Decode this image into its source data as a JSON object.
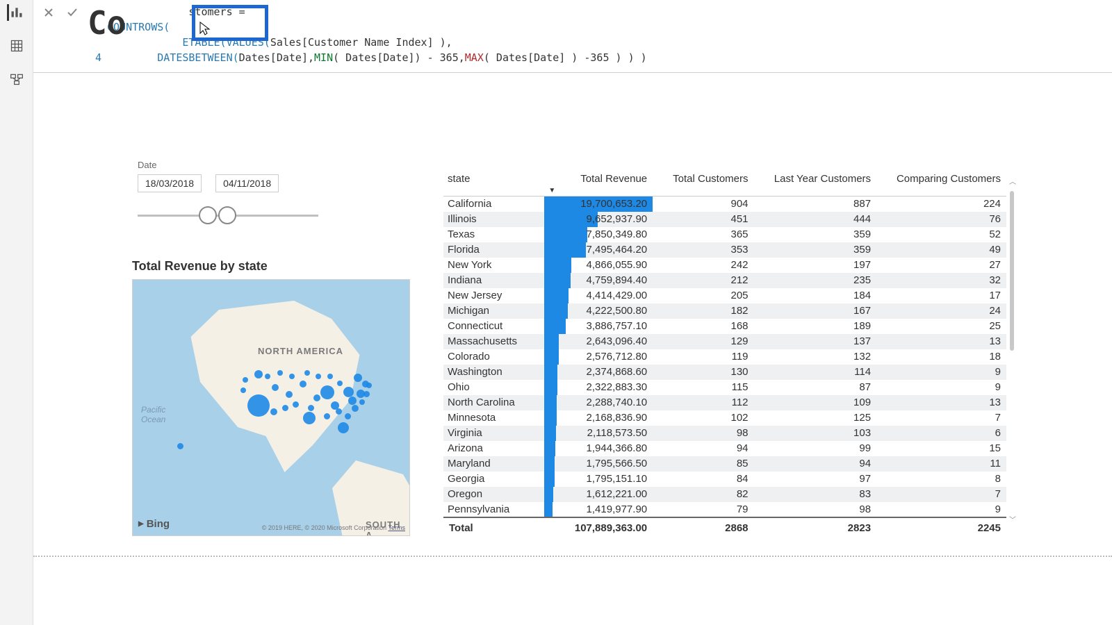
{
  "page_title_behind": "Co",
  "formula": {
    "line1_suffix": "stomers =",
    "countrows": "COUNTROWS(",
    "calculatetable_tail": "ETABLE(",
    "values_fn": "VALUES(",
    "values_arg": " Sales[Customer Name Index] ),",
    "line4_gutter": "4",
    "datesbetween": "DATESBETWEEN(",
    "dates_arg1": " Dates[Date], ",
    "min": "MIN",
    "min_tail": "( Dates[Date]) - 365, ",
    "max": "MAX",
    "max_tail": "( Dates[Date] ) -365 ) ) )"
  },
  "date_slicer": {
    "label": "Date",
    "from": "18/03/2018",
    "to": "04/11/2018"
  },
  "map": {
    "title": "Total Revenue by state",
    "continent": "NORTH AMERICA",
    "continent2": "SOUTH A",
    "ocean": "Pacific\nOcean",
    "bing": "Bing",
    "attrib": "© 2019 HERE, © 2020 Microsoft Corporation",
    "terms": "Terms"
  },
  "table": {
    "headers": {
      "state": "state",
      "rev": "Total Revenue",
      "cust": "Total Customers",
      "ly": "Last Year Customers",
      "comp": "Comparing Customers"
    },
    "max_revenue": 19700653.2,
    "rows": [
      {
        "state": "California",
        "rev": "19,700,653.20",
        "rev_n": 19700653.2,
        "cust": "904",
        "ly": "887",
        "comp": "224"
      },
      {
        "state": "Illinois",
        "rev": "9,652,937.90",
        "rev_n": 9652937.9,
        "cust": "451",
        "ly": "444",
        "comp": "76"
      },
      {
        "state": "Texas",
        "rev": "7,850,349.80",
        "rev_n": 7850349.8,
        "cust": "365",
        "ly": "359",
        "comp": "52"
      },
      {
        "state": "Florida",
        "rev": "7,495,464.20",
        "rev_n": 7495464.2,
        "cust": "353",
        "ly": "359",
        "comp": "49"
      },
      {
        "state": "New York",
        "rev": "4,866,055.90",
        "rev_n": 4866055.9,
        "cust": "242",
        "ly": "197",
        "comp": "27"
      },
      {
        "state": "Indiana",
        "rev": "4,759,894.40",
        "rev_n": 4759894.4,
        "cust": "212",
        "ly": "235",
        "comp": "32"
      },
      {
        "state": "New Jersey",
        "rev": "4,414,429.00",
        "rev_n": 4414429.0,
        "cust": "205",
        "ly": "184",
        "comp": "17"
      },
      {
        "state": "Michigan",
        "rev": "4,222,500.80",
        "rev_n": 4222500.8,
        "cust": "182",
        "ly": "167",
        "comp": "24"
      },
      {
        "state": "Connecticut",
        "rev": "3,886,757.10",
        "rev_n": 3886757.1,
        "cust": "168",
        "ly": "189",
        "comp": "25"
      },
      {
        "state": "Massachusetts",
        "rev": "2,643,096.40",
        "rev_n": 2643096.4,
        "cust": "129",
        "ly": "137",
        "comp": "13"
      },
      {
        "state": "Colorado",
        "rev": "2,576,712.80",
        "rev_n": 2576712.8,
        "cust": "119",
        "ly": "132",
        "comp": "18"
      },
      {
        "state": "Washington",
        "rev": "2,374,868.60",
        "rev_n": 2374868.6,
        "cust": "130",
        "ly": "114",
        "comp": "9"
      },
      {
        "state": "Ohio",
        "rev": "2,322,883.30",
        "rev_n": 2322883.3,
        "cust": "115",
        "ly": "87",
        "comp": "9"
      },
      {
        "state": "North Carolina",
        "rev": "2,288,740.10",
        "rev_n": 2288740.1,
        "cust": "112",
        "ly": "109",
        "comp": "13"
      },
      {
        "state": "Minnesota",
        "rev": "2,168,836.90",
        "rev_n": 2168836.9,
        "cust": "102",
        "ly": "125",
        "comp": "7"
      },
      {
        "state": "Virginia",
        "rev": "2,118,573.50",
        "rev_n": 2118573.5,
        "cust": "98",
        "ly": "103",
        "comp": "6"
      },
      {
        "state": "Arizona",
        "rev": "1,944,366.80",
        "rev_n": 1944366.8,
        "cust": "94",
        "ly": "99",
        "comp": "15"
      },
      {
        "state": "Maryland",
        "rev": "1,795,566.50",
        "rev_n": 1795566.5,
        "cust": "85",
        "ly": "94",
        "comp": "11"
      },
      {
        "state": "Georgia",
        "rev": "1,795,151.10",
        "rev_n": 1795151.1,
        "cust": "84",
        "ly": "97",
        "comp": "8"
      },
      {
        "state": "Oregon",
        "rev": "1,612,221.00",
        "rev_n": 1612221.0,
        "cust": "82",
        "ly": "83",
        "comp": "7"
      },
      {
        "state": "Pennsylvania",
        "rev": "1,419,977.90",
        "rev_n": 1419977.9,
        "cust": "79",
        "ly": "98",
        "comp": "9"
      }
    ],
    "total": {
      "label": "Total",
      "rev": "107,889,363.00",
      "cust": "2868",
      "ly": "2823",
      "comp": "2245"
    }
  },
  "chart_data": {
    "type": "table",
    "title": "Total Revenue by state",
    "columns": [
      "state",
      "Total Revenue",
      "Total Customers",
      "Last Year Customers",
      "Comparing Customers"
    ],
    "rows": [
      [
        "California",
        19700653.2,
        904,
        887,
        224
      ],
      [
        "Illinois",
        9652937.9,
        451,
        444,
        76
      ],
      [
        "Texas",
        7850349.8,
        365,
        359,
        52
      ],
      [
        "Florida",
        7495464.2,
        353,
        359,
        49
      ],
      [
        "New York",
        4866055.9,
        242,
        197,
        27
      ],
      [
        "Indiana",
        4759894.4,
        212,
        235,
        32
      ],
      [
        "New Jersey",
        4414429.0,
        205,
        184,
        17
      ],
      [
        "Michigan",
        4222500.8,
        182,
        167,
        24
      ],
      [
        "Connecticut",
        3886757.1,
        168,
        189,
        25
      ],
      [
        "Massachusetts",
        2643096.4,
        129,
        137,
        13
      ],
      [
        "Colorado",
        2576712.8,
        119,
        132,
        18
      ],
      [
        "Washington",
        2374868.6,
        130,
        114,
        9
      ],
      [
        "Ohio",
        2322883.3,
        115,
        87,
        9
      ],
      [
        "North Carolina",
        2288740.1,
        112,
        109,
        13
      ],
      [
        "Minnesota",
        2168836.9,
        102,
        125,
        7
      ],
      [
        "Virginia",
        2118573.5,
        98,
        103,
        6
      ],
      [
        "Arizona",
        1944366.8,
        94,
        99,
        15
      ],
      [
        "Maryland",
        1795566.5,
        85,
        94,
        11
      ],
      [
        "Georgia",
        1795151.1,
        84,
        97,
        8
      ],
      [
        "Oregon",
        1612221.0,
        82,
        83,
        7
      ],
      [
        "Pennsylvania",
        1419977.9,
        79,
        98,
        9
      ]
    ],
    "totals": [
      "Total",
      107889363.0,
      2868,
      2823,
      2245
    ]
  }
}
